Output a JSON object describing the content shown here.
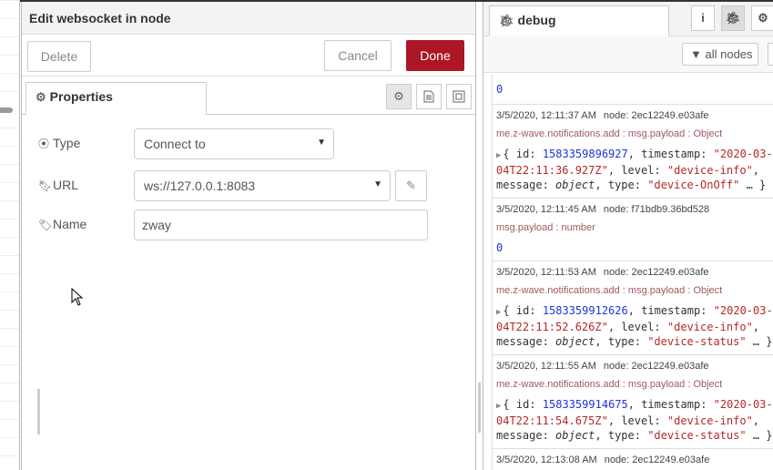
{
  "tray": {
    "title": "Edit websocket in node",
    "buttons": {
      "delete": "Delete",
      "cancel": "Cancel",
      "done": "Done"
    },
    "tab_label": "Properties",
    "fields": {
      "type": {
        "label": "Type",
        "value": "Connect to"
      },
      "url": {
        "label": "URL",
        "value": "ws://127.0.0.1:8083"
      },
      "name": {
        "label": "Name",
        "value": "zway"
      }
    }
  },
  "sidebar": {
    "tab_label": "debug",
    "filter_label": "all nodes",
    "messages": [
      {
        "value": "0"
      },
      {
        "time": "3/5/2020, 12:11:37 AM",
        "node": "node: 2ec12249.e03afe",
        "topic": "me.z-wave.notifications.add : msg.payload : Object",
        "id": "1583359896927",
        "timestamp_a": "\"2020-03-",
        "timestamp_b": "04T22:11:36.927Z\"",
        "level": "\"device-info\"",
        "type": "\"device-OnOff\""
      },
      {
        "time": "3/5/2020, 12:11:45 AM",
        "node": "node: f71bdb9.36bd528",
        "topic": "msg.payload : number",
        "value": "0"
      },
      {
        "time": "3/5/2020, 12:11:53 AM",
        "node": "node: 2ec12249.e03afe",
        "topic": "me.z-wave.notifications.add : msg.payload : Object",
        "id": "1583359912626",
        "timestamp_a": "\"2020-03-",
        "timestamp_b": "04T22:11:52.626Z\"",
        "level": "\"device-info\"",
        "type": "\"device-status\""
      },
      {
        "time": "3/5/2020, 12:11:55 AM",
        "node": "node: 2ec12249.e03afe",
        "topic": "me.z-wave.notifications.add : msg.payload : Object",
        "id": "1583359914675",
        "timestamp_a": "\"2020-03-",
        "timestamp_b": "04T22:11:54.675Z\"",
        "level": "\"device-info\"",
        "type": "\"device-status\""
      },
      {
        "time": "3/5/2020, 12:13:08 AM",
        "node": "node: 2ec12249.e03afe"
      }
    ],
    "labels": {
      "open": "{",
      "id_key": "id:",
      "ts_key": "timestamp:",
      "level_key": "level:",
      "message_key": "message:",
      "object_word": "object",
      "type_key": "type:",
      "ellipsis": "… }"
    }
  }
}
